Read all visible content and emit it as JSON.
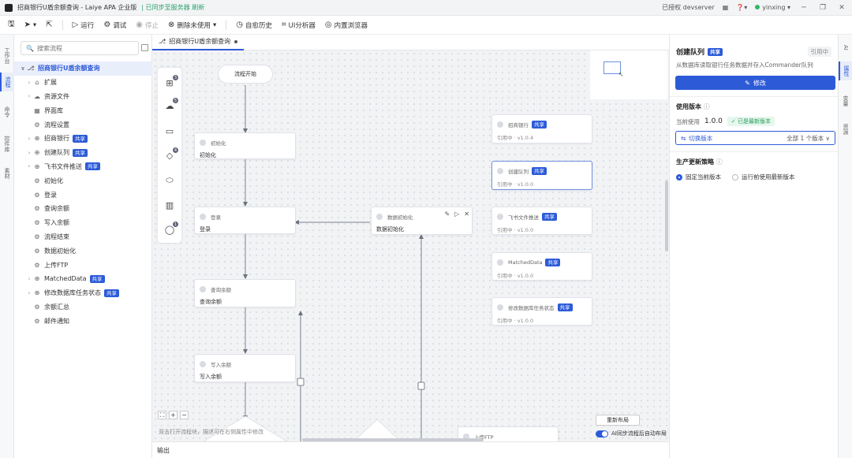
{
  "titlebar": {
    "app_title": "招商银行U盾余额查询 - Laiye APA 企业版",
    "sync_status": "| 已同步至服务器 刷新",
    "login": "已授权 devserver",
    "user": "yinxing"
  },
  "toolbar": {
    "run": "运行",
    "debug": "调试",
    "stop": "停止",
    "delete_unused": "删除未使用",
    "history": "自愈历史",
    "ui_analyzer": "UI分析器",
    "browser": "内置浏览器"
  },
  "leftrail": {
    "items": [
      "工作台",
      "流程",
      "命令",
      "控件库",
      "素材"
    ]
  },
  "sidebar": {
    "search_placeholder": "搜索流程",
    "tree": [
      {
        "label": "招商银行U盾余额查询",
        "level": 0,
        "expandable": true,
        "root": true,
        "icon": "flow-icon"
      },
      {
        "label": "扩展",
        "level": 1,
        "expandable": true,
        "icon": "home-icon"
      },
      {
        "label": "资源文件",
        "level": 1,
        "expandable": true,
        "icon": "cloud-icon"
      },
      {
        "label": "界面库",
        "level": 1,
        "expandable": false,
        "icon": "grid-icon"
      },
      {
        "label": "流程设置",
        "level": 1,
        "expandable": false,
        "icon": "gear-icon"
      },
      {
        "label": "招商银行",
        "level": 1,
        "expandable": true,
        "badge": "共享",
        "icon": "component-icon"
      },
      {
        "label": "创建队列",
        "level": 1,
        "expandable": true,
        "badge": "共享",
        "icon": "component-icon"
      },
      {
        "label": "飞书文件推送",
        "level": 1,
        "expandable": true,
        "badge": "共享",
        "icon": "component-icon"
      },
      {
        "label": "初始化",
        "level": 1,
        "expandable": false,
        "icon": "gear-icon"
      },
      {
        "label": "登录",
        "level": 1,
        "expandable": false,
        "icon": "gear-icon"
      },
      {
        "label": "查询余额",
        "level": 1,
        "expandable": false,
        "icon": "gear-icon"
      },
      {
        "label": "写入余额",
        "level": 1,
        "expandable": false,
        "icon": "gear-icon"
      },
      {
        "label": "流程结束",
        "level": 1,
        "expandable": false,
        "icon": "gear-icon"
      },
      {
        "label": "数据初始化",
        "level": 1,
        "expandable": false,
        "icon": "gear-icon"
      },
      {
        "label": "上传FTP",
        "level": 1,
        "expandable": false,
        "icon": "gear-icon"
      },
      {
        "label": "MatchedData",
        "level": 1,
        "expandable": true,
        "badge": "共享",
        "icon": "component-icon"
      },
      {
        "label": "修改数据库任务状态",
        "level": 1,
        "expandable": true,
        "badge": "共享",
        "icon": "component-icon"
      },
      {
        "label": "余额汇总",
        "level": 1,
        "expandable": false,
        "icon": "gear-icon"
      },
      {
        "label": "邮件通知",
        "level": 1,
        "expandable": false,
        "icon": "gear-icon"
      }
    ]
  },
  "tab": {
    "label": "招商银行U盾余额查询"
  },
  "canvas": {
    "start": "流程开始",
    "nodes": [
      {
        "key": "init",
        "head": "初始化",
        "body": "初始化"
      },
      {
        "key": "login",
        "head": "登录",
        "body": "登录"
      },
      {
        "key": "dataInit",
        "head": "数据初始化",
        "body": "数据初始化"
      },
      {
        "key": "query",
        "head": "查询余额",
        "body": "查询余额"
      },
      {
        "key": "write",
        "head": "写入余额",
        "body": "写入余额"
      },
      {
        "key": "ftp",
        "head": "上传FTP",
        "body": ""
      }
    ],
    "refs": [
      {
        "head": "招商银行",
        "badge": "共享",
        "body": "引用中 · v1.0.4"
      },
      {
        "head": "创建队列",
        "badge": "共享",
        "body": "引用中 · v1.0.0"
      },
      {
        "head": "飞书文件推送",
        "badge": "共享",
        "body": "引用中 · v1.0.0"
      },
      {
        "head": "MatchedData",
        "badge": "共享",
        "body": "引用中 · v1.0.0"
      },
      {
        "head": "修改数据库任务状态",
        "badge": "共享",
        "body": "引用中 · v1.0.0"
      }
    ],
    "palette_badges": [
      "3",
      "5",
      "4",
      "1"
    ],
    "hint": "双击打开流程块，描述可在右侧属性中修改",
    "relayout": "重新布局",
    "ai_toggle": "AI同步流程后自动布局",
    "output": "输出",
    "accent": "#2d5bd8"
  },
  "rightpanel": {
    "title": "创建队列",
    "title_badge": "共享",
    "status": "引用中",
    "desc": "从数据库读取银行任务数据并存入Commander队列",
    "edit": "修改",
    "version_h": "使用版本",
    "current_label": "当前使用",
    "current_version": "1.0.0",
    "latest": "已是最新版本",
    "switch_version": "切换版本",
    "all_versions": "全部 1 个版本",
    "update_h": "生产更新策略",
    "opt_fixed": "固定当前版本",
    "opt_latest": "运行前使用最新版本"
  },
  "rightrail": {
    "items": [
      "AI",
      "属性",
      "变量",
      "资源"
    ]
  }
}
